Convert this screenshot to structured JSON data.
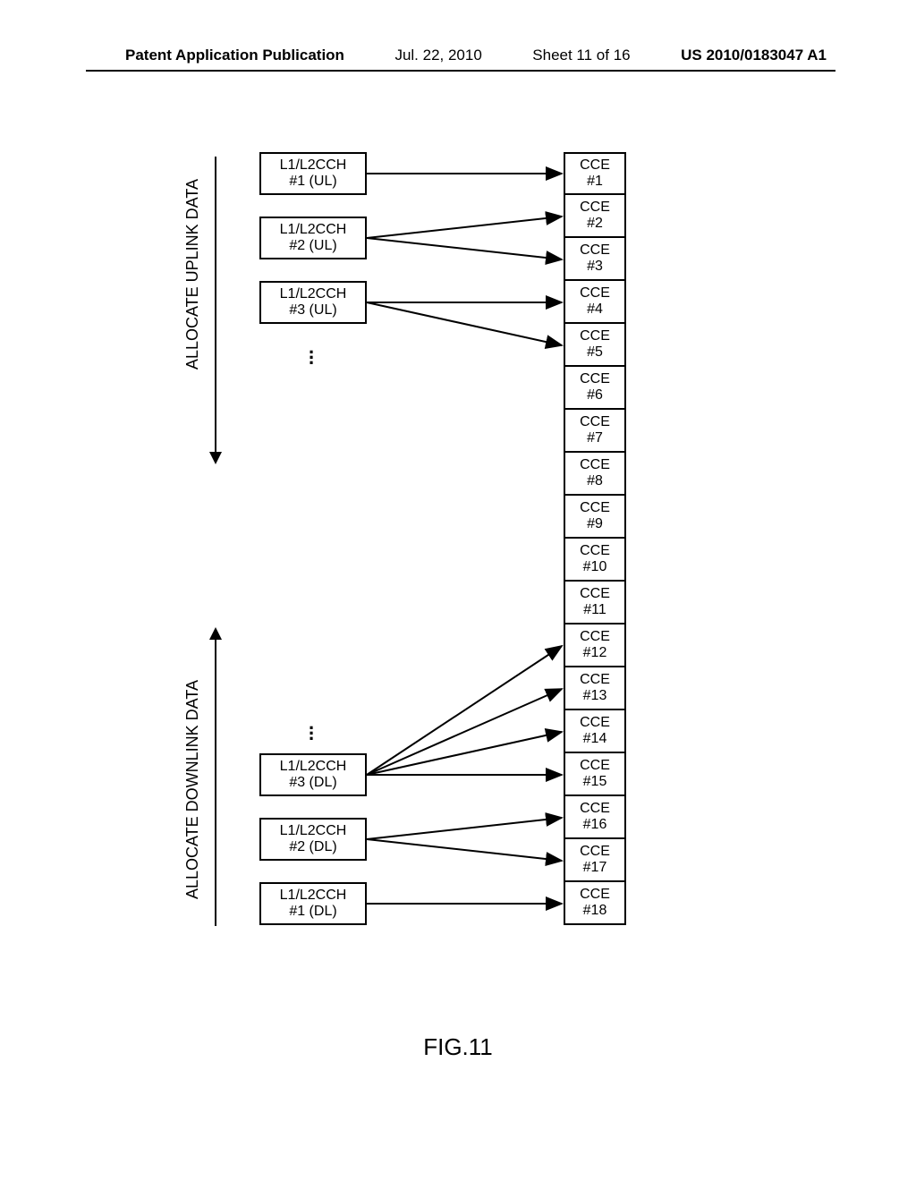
{
  "header": {
    "pubtype": "Patent Application Publication",
    "date": "Jul. 22, 2010",
    "sheet": "Sheet 11 of 16",
    "pubno": "US 2010/0183047 A1"
  },
  "labels": {
    "uplink": "ALLOCATE UPLINK DATA",
    "downlink": "ALLOCATE DOWNLINK DATA"
  },
  "ul_channels": [
    {
      "top": "L1/L2CCH",
      "bottom": "#1  (UL)"
    },
    {
      "top": "L1/L2CCH",
      "bottom": "#2  (UL)"
    },
    {
      "top": "L1/L2CCH",
      "bottom": "#3  (UL)"
    }
  ],
  "dl_channels": [
    {
      "top": "L1/L2CCH",
      "bottom": "#3  (DL)"
    },
    {
      "top": "L1/L2CCH",
      "bottom": "#2  (DL)"
    },
    {
      "top": "L1/L2CCH",
      "bottom": "#1  (DL)"
    }
  ],
  "cce_prefix": "CCE",
  "cce_count": 18,
  "figure_caption": "FIG.11",
  "chart_data": {
    "type": "diagram",
    "mappings": [
      {
        "channel": "L1/L2CCH #1 (UL)",
        "cces": [
          1
        ]
      },
      {
        "channel": "L1/L2CCH #2 (UL)",
        "cces": [
          2,
          3
        ]
      },
      {
        "channel": "L1/L2CCH #3 (UL)",
        "cces": [
          4,
          5
        ]
      },
      {
        "channel": "L1/L2CCH #3 (DL)",
        "cces": [
          12,
          13,
          14,
          15
        ]
      },
      {
        "channel": "L1/L2CCH #2 (DL)",
        "cces": [
          16,
          17
        ]
      },
      {
        "channel": "L1/L2CCH #1 (DL)",
        "cces": [
          18
        ]
      }
    ]
  }
}
